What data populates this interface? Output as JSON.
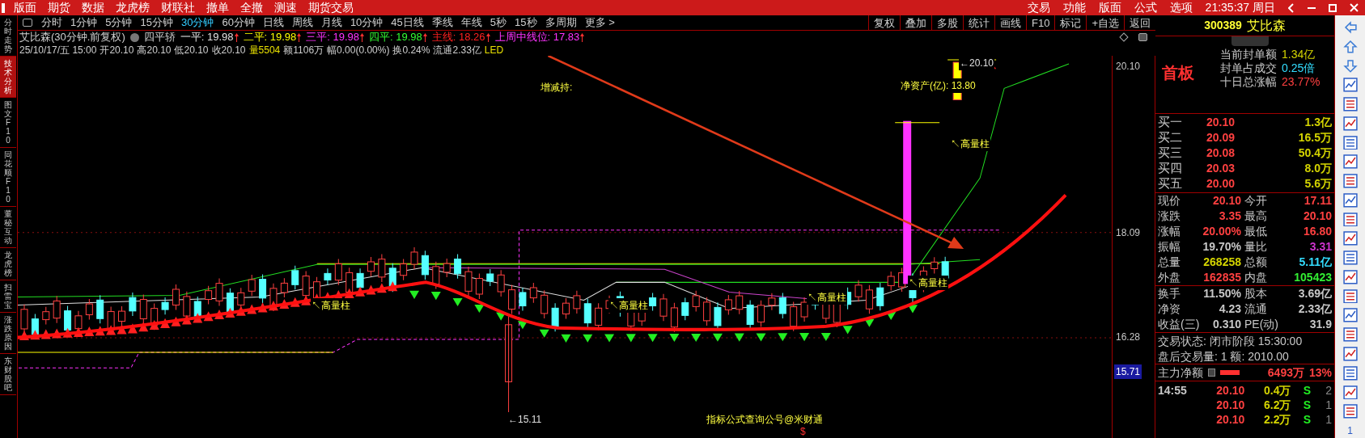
{
  "menu": {
    "left": [
      "版面",
      "期货",
      "数据",
      "龙虎榜",
      "财联社",
      "撤单",
      "全撤",
      "测速",
      "期货交易"
    ],
    "right": [
      "交易",
      "功能",
      "版面",
      "公式",
      "选项"
    ],
    "clock": "21:35:37 周日"
  },
  "side_tabs": [
    {
      "label": "分时走势",
      "selected": false
    },
    {
      "label": "技术分析",
      "selected": true
    },
    {
      "label": "图文F10",
      "selected": false
    },
    {
      "label": "同花顺F10",
      "selected": false
    },
    {
      "label": "董秘互动",
      "selected": false
    },
    {
      "label": "龙虎榜",
      "selected": false
    },
    {
      "label": "扫雷宝",
      "selected": false
    },
    {
      "label": "涨跌原因",
      "selected": false
    },
    {
      "label": "东财股吧",
      "selected": false
    }
  ],
  "periods": [
    {
      "label": "分时",
      "selected": false
    },
    {
      "label": "1分钟",
      "selected": false
    },
    {
      "label": "5分钟",
      "selected": false
    },
    {
      "label": "15分钟",
      "selected": false
    },
    {
      "label": "30分钟",
      "selected": true
    },
    {
      "label": "60分钟",
      "selected": false
    },
    {
      "label": "日线",
      "selected": false
    },
    {
      "label": "周线",
      "selected": false
    },
    {
      "label": "月线",
      "selected": false
    },
    {
      "label": "10分钟",
      "selected": false
    },
    {
      "label": "45日线",
      "selected": false
    },
    {
      "label": "季线",
      "selected": false
    },
    {
      "label": "年线",
      "selected": false
    },
    {
      "label": "5秒",
      "selected": false
    },
    {
      "label": "15秒",
      "selected": false
    },
    {
      "label": "多周期",
      "selected": false
    },
    {
      "label": "更多 >",
      "selected": false
    }
  ],
  "toolbar": [
    "复权",
    "叠加",
    "多股",
    "统计",
    "画线",
    "F10",
    "标记",
    "+自选",
    "返回"
  ],
  "header": {
    "title": "艾比森(30分钟.前复权)",
    "indicator": "四平轿",
    "lines": [
      {
        "text": "一平: 19.98",
        "color": "#e0e0e0"
      },
      {
        "text": "二平: 19.98",
        "color": "#ffff00"
      },
      {
        "text": "三平: 19.98",
        "color": "#ff33ff"
      },
      {
        "text": "四平: 19.98",
        "color": "#33ff33"
      },
      {
        "text": "主线: 18.26",
        "color": "#ff2020"
      },
      {
        "text": "上周中线位: 17.83",
        "color": "#ff33ff"
      }
    ]
  },
  "bar_info": [
    {
      "text": "25/10/17/五 15:00",
      "color": "#d0d0d0"
    },
    {
      "text": "开20.10",
      "color": "#d0d0d0"
    },
    {
      "text": "高20.10",
      "color": "#d0d0d0"
    },
    {
      "text": "低20.10",
      "color": "#d0d0d0"
    },
    {
      "text": "收20.10",
      "color": "#d0d0d0"
    },
    {
      "text": "量5504",
      "color": "#e8e000"
    },
    {
      "text": "额1106万",
      "color": "#d0d0d0"
    },
    {
      "text": "幅0.00(0.00%)",
      "color": "#d0d0d0"
    },
    {
      "text": "换0.24%",
      "color": "#d0d0d0"
    },
    {
      "text": "流通2.33亿",
      "color": "#d0d0d0"
    },
    {
      "text": "LED",
      "color": "#e8e000"
    }
  ],
  "chart": {
    "axis_labels": [
      {
        "text": "20.10",
        "highlighted": false
      },
      {
        "text": "18.09",
        "highlighted": false
      },
      {
        "text": "16.28",
        "highlighted": false
      },
      {
        "text": "15.71",
        "highlighted": true
      }
    ],
    "notes": [
      {
        "kind": "label",
        "text": "增减持:"
      },
      {
        "kind": "label",
        "text": "净资产(亿): 13.80"
      },
      {
        "kind": "volume",
        "text": "↖高量柱"
      },
      {
        "kind": "volume",
        "text": "↖高量柱"
      },
      {
        "kind": "volume",
        "text": "↖高量柱"
      },
      {
        "kind": "volume",
        "text": "↖高量柱"
      },
      {
        "kind": "volume",
        "text": "↖高量柱"
      },
      {
        "kind": "price",
        "text": "←20.10"
      },
      {
        "kind": "price",
        "text": "←15.11"
      },
      {
        "kind": "label",
        "text": "指标公式查询公号@米财通"
      },
      {
        "kind": "mark",
        "text": "$"
      }
    ]
  },
  "quote": {
    "code": "300389",
    "name": "艾比森",
    "badge": "首板",
    "stats": [
      {
        "label": "当前封单额",
        "value": "1.34亿",
        "color": "#d4d400"
      },
      {
        "label": "封单占成交",
        "value": "0.25倍",
        "color": "#33ddff"
      },
      {
        "label": "十日总涨幅",
        "value": "23.77%",
        "color": "#ff4040"
      }
    ],
    "book": [
      {
        "label": "买一",
        "price": "20.10",
        "volume": "1.3亿"
      },
      {
        "label": "买二",
        "price": "20.09",
        "volume": "16.5万"
      },
      {
        "label": "买三",
        "price": "20.08",
        "volume": "50.4万"
      },
      {
        "label": "买四",
        "price": "20.03",
        "volume": "8.0万"
      },
      {
        "label": "买五",
        "price": "20.00",
        "volume": "5.6万"
      }
    ],
    "grid1": [
      {
        "cells": [
          {
            "label": "现价",
            "value": "20.10",
            "color": "#ff4040"
          },
          {
            "label": "今开",
            "value": "17.11",
            "color": "#ff4040"
          }
        ]
      },
      {
        "cells": [
          {
            "label": "涨跌",
            "value": "3.35",
            "color": "#ff4040"
          },
          {
            "label": "最高",
            "value": "20.10",
            "color": "#ff4040"
          }
        ]
      },
      {
        "cells": [
          {
            "label": "涨幅",
            "value": "20.00%",
            "color": "#ff4040"
          },
          {
            "label": "最低",
            "value": "16.80",
            "color": "#ff4040"
          }
        ]
      },
      {
        "cells": [
          {
            "label": "振幅",
            "value": "19.70%",
            "color": "#c8c8c8"
          },
          {
            "label": "量比",
            "value": "3.31",
            "color": "#cc33cc"
          }
        ]
      },
      {
        "cells": [
          {
            "label": "总量",
            "value": "268258",
            "color": "#d4d400"
          },
          {
            "label": "总额",
            "value": "5.11亿",
            "color": "#33ddff"
          }
        ]
      },
      {
        "cells": [
          {
            "label": "外盘",
            "value": "162835",
            "color": "#ff4040"
          },
          {
            "label": "内盘",
            "value": "105423",
            "color": "#33ee33"
          }
        ]
      }
    ],
    "grid2": [
      {
        "cells": [
          {
            "label": "换手",
            "value": "11.50%"
          },
          {
            "label": "股本",
            "value": "3.69亿"
          }
        ]
      },
      {
        "cells": [
          {
            "label": "净资",
            "value": "4.23"
          },
          {
            "label": "流通",
            "value": "2.33亿"
          }
        ]
      },
      {
        "cells": [
          {
            "label": "收益(三)",
            "value": "0.310"
          },
          {
            "label": "PE(动)",
            "value": "31.9"
          }
        ]
      }
    ],
    "status": [
      "交易状态: 闭市阶段 15:30:00",
      "盘后交易量: 1  额: 2010.00"
    ],
    "main_force": {
      "label": "主力净额",
      "value": "6493万",
      "percent": "13%"
    },
    "ticks": [
      {
        "time": "14:55",
        "price": "20.10",
        "volume": "0.4万",
        "side": "S",
        "count": "2"
      },
      {
        "price": "20.10",
        "volume": "6.2万",
        "side": "S",
        "count": "1"
      },
      {
        "price": "20.10",
        "volume": "2.2万",
        "side": "S",
        "count": "1"
      }
    ]
  },
  "side_toolbar_page": "1"
}
